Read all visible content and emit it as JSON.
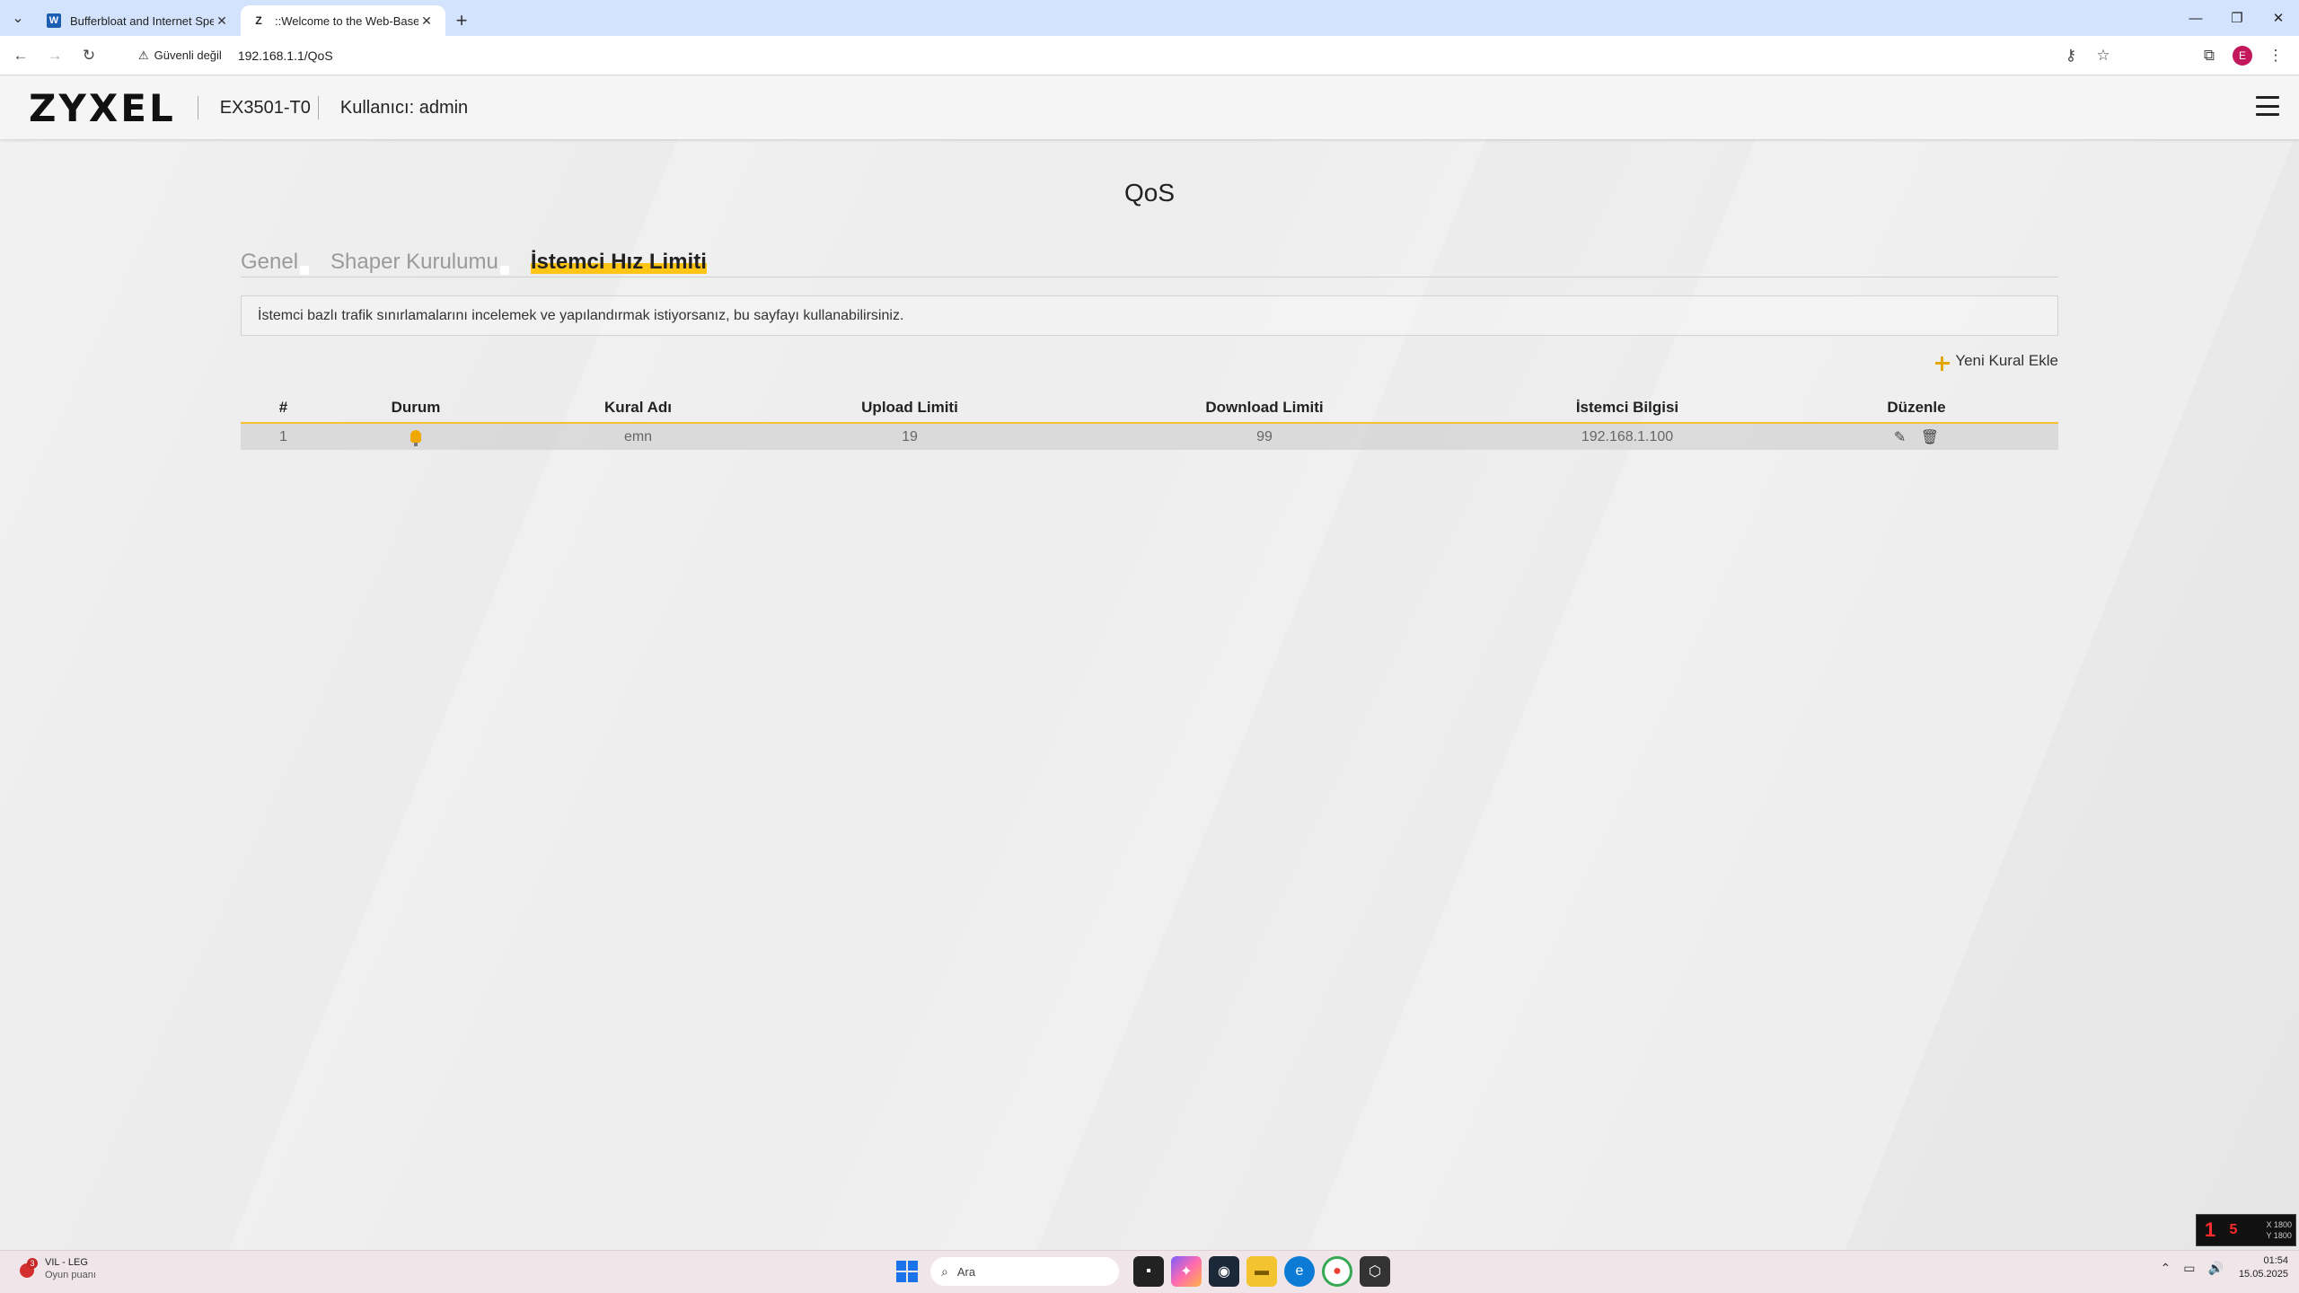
{
  "browser": {
    "tabs": [
      {
        "title": "Bufferbloat and Internet Speed",
        "favicon": "W",
        "active": false
      },
      {
        "title": "::Welcome to the Web-Based C",
        "favicon": "Z",
        "active": true
      }
    ],
    "security_label": "Güvenli değil",
    "url": "192.168.1.1/QoS",
    "profile_initial": "E"
  },
  "router": {
    "logo": "ZYXEL",
    "model": "EX3501-T0",
    "user_label": "Kullanıcı: admin",
    "page_title": "QoS",
    "tabs": [
      {
        "label": "Genel",
        "active": false
      },
      {
        "label": "Shaper Kurulumu",
        "active": false
      },
      {
        "label": "İstemci Hız Limiti",
        "active": true
      }
    ],
    "info_text": "İstemci bazlı trafik sınırlamalarını incelemek ve yapılandırmak istiyorsanız, bu sayfayı kullanabilirsiniz.",
    "add_rule_label": "Yeni Kural Ekle",
    "table": {
      "headers": [
        "#",
        "Durum",
        "Kural Adı",
        "Upload Limiti",
        "Download Limiti",
        "İstemci Bilgisi",
        "Düzenle"
      ],
      "rows": [
        {
          "index": "1",
          "status": "bulb-icon",
          "name": "emn",
          "upload": "19",
          "download": "99",
          "client": "192.168.1.100"
        }
      ]
    }
  },
  "taskbar": {
    "weather_title": "VIL - LEG",
    "weather_sub": "Oyun puanı",
    "weather_badge": "3",
    "search_placeholder": "Ara",
    "time": "01:54",
    "date": "15.05.2025"
  },
  "overlay": {
    "num1": "1",
    "num2": "5",
    "x": "X 1800",
    "y": "Y 1800"
  },
  "colors": {
    "accent": "#ffc515",
    "tabbar": "#d3e3fd",
    "taskbar": "#f0e6ea"
  }
}
